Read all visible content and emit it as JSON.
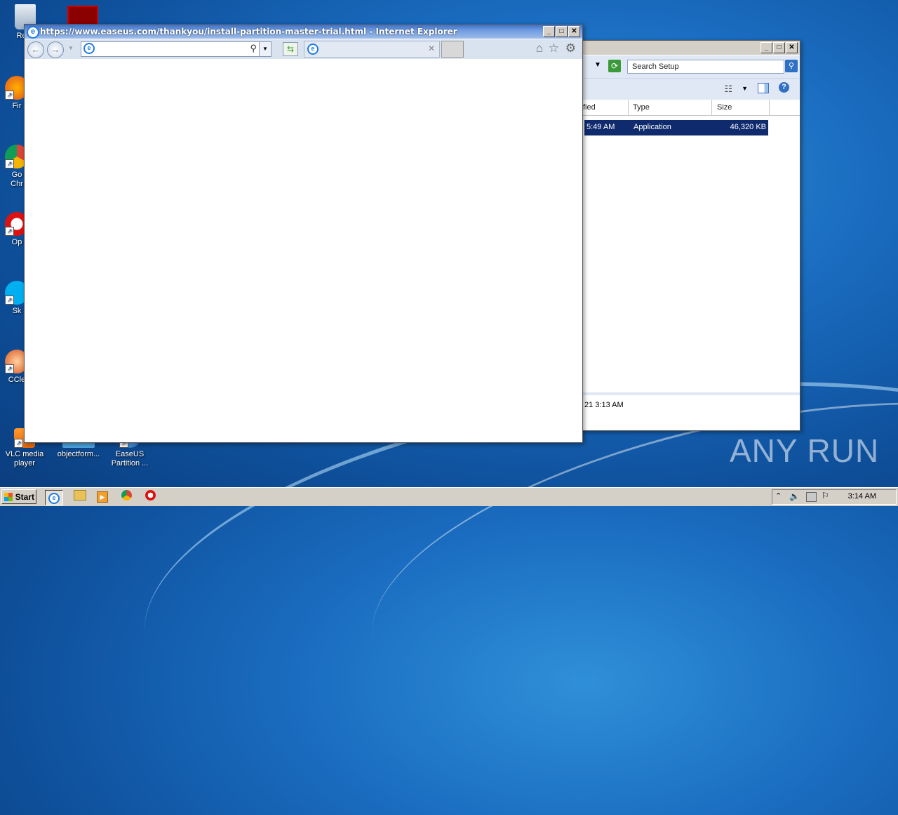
{
  "desktop": {
    "icons": [
      {
        "label": "Recy",
        "icon": "recycle-bin-icon"
      },
      {
        "label": "Fir",
        "icon": "firefox-icon"
      },
      {
        "label": "Go\nChr",
        "icon": "chrome-icon"
      },
      {
        "label": "Op",
        "icon": "opera-icon"
      },
      {
        "label": "Sk",
        "icon": "skype-icon"
      },
      {
        "label": "CCle",
        "icon": "ccleaner-icon"
      },
      {
        "label": "VLC media player",
        "icon": "vlc-icon"
      },
      {
        "label": "objectform...",
        "icon": "folder-icon"
      },
      {
        "label": "EaseUS Partition ...",
        "icon": "easeus-icon"
      }
    ]
  },
  "ie_window": {
    "title": "https://www.easeus.com/thankyou/install-partition-master-trial.html - Internet Explorer",
    "address_value": "",
    "tab_title": "",
    "controls": {
      "minimize": "_",
      "maximize": "□",
      "close": "✕"
    }
  },
  "explorer_window": {
    "search_placeholder": "Search Setup",
    "columns": {
      "modified": "fied",
      "type": "Type",
      "size": "Size"
    },
    "row": {
      "modified": "5:49 AM",
      "type": "Application",
      "size": "46,320 KB"
    },
    "details_text": "21 3:13 AM"
  },
  "taskbar": {
    "start_label": "Start",
    "clock": "3:14 AM"
  },
  "watermark": "ANY RUN",
  "colors": {
    "selection": "#0f2a6d",
    "ie_title": "#3a6fc6"
  }
}
